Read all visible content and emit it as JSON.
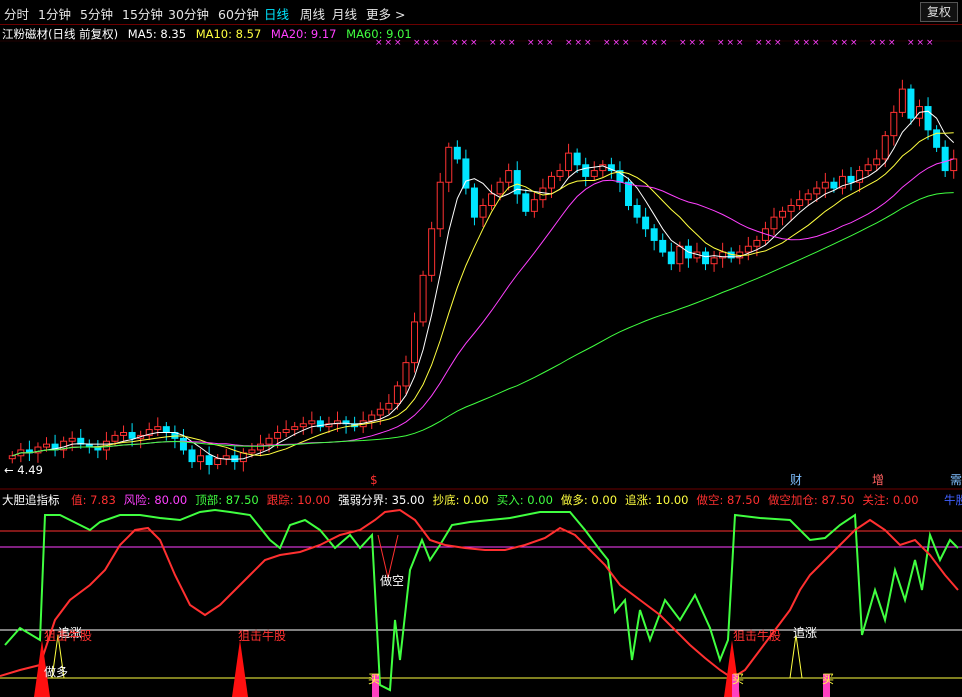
{
  "toolbar": {
    "tabs": [
      {
        "label": "分时"
      },
      {
        "label": "1分钟"
      },
      {
        "label": "5分钟"
      },
      {
        "label": "15分钟"
      },
      {
        "label": "30分钟"
      },
      {
        "label": "60分钟"
      },
      {
        "label": "日线",
        "active": true
      },
      {
        "label": "周线"
      },
      {
        "label": "月线"
      },
      {
        "label": "更多 >"
      }
    ],
    "fuquan_label": "复权"
  },
  "main_legend": {
    "title": "江粉磁材(日线 前复权)",
    "ma5": "MA5: 8.35",
    "ma10": "MA10: 8.57",
    "ma20": "MA20: 9.17",
    "ma60": "MA60: 9.01",
    "low_label": "← 4.49"
  },
  "event_markers": [
    {
      "label": "$",
      "color": "#ff3030"
    },
    {
      "label": "财",
      "color": "#7fbfff"
    },
    {
      "label": "增",
      "color": "#ff6060"
    },
    {
      "label": "需",
      "color": "#7fbfff"
    }
  ],
  "indicator_legend": {
    "name": "大胆追指标",
    "items": [
      {
        "text": "值: 7.83",
        "color": "#ff3030"
      },
      {
        "text": "风险: 80.00",
        "color": "#ff40ff"
      },
      {
        "text": "顶部: 87.50",
        "color": "#40ff40"
      },
      {
        "text": "跟踪: 10.00",
        "color": "#ff3030"
      },
      {
        "text": "强弱分界: 35.00",
        "color": "#ffffff"
      },
      {
        "text": "抄底: 0.00",
        "color": "#ffff40"
      },
      {
        "text": "买入: 0.00",
        "color": "#40ff40"
      },
      {
        "text": "做多: 0.00",
        "color": "#ffff40"
      },
      {
        "text": "追涨: 10.00",
        "color": "#ffff40"
      },
      {
        "text": "做空: 87.50",
        "color": "#ff3030"
      },
      {
        "text": "做空加仓: 87.50",
        "color": "#ff3030"
      },
      {
        "text": "关注: 0.00",
        "color": "#ff3030"
      }
    ],
    "extra": "牛股"
  },
  "signals": [
    {
      "text": "追涨",
      "color": "#ffffff"
    },
    {
      "text": "狙击牛股",
      "color": "#ff3030"
    },
    {
      "text": "狙击牛股",
      "color": "#ff3030"
    },
    {
      "text": "做空",
      "color": "#ffffff"
    },
    {
      "text": "狙击牛股",
      "color": "#ff3030"
    },
    {
      "text": "追涨",
      "color": "#ffffff"
    },
    {
      "text": "做多",
      "color": "#ffffff"
    },
    {
      "text": "买",
      "color": "#ffff40"
    },
    {
      "text": "买",
      "color": "#ffff40"
    },
    {
      "text": "买",
      "color": "#ffff40"
    }
  ],
  "colors": {
    "up": "#ff3232",
    "down": "#00e5ff",
    "ma5": "#ffffff",
    "ma10": "#ffff40",
    "ma20": "#ff40ff",
    "ma60": "#40ff40"
  },
  "chart_data": {
    "type": "candlestick",
    "price_range": [
      4.49,
      11.5
    ],
    "low_marker": 4.49,
    "closes": [
      4.7,
      4.8,
      4.75,
      4.85,
      4.9,
      4.8,
      4.95,
      5.0,
      4.9,
      4.85,
      4.8,
      4.95,
      5.05,
      5.1,
      5.0,
      5.05,
      5.15,
      5.2,
      5.1,
      5.0,
      4.8,
      4.6,
      4.7,
      4.55,
      4.65,
      4.7,
      4.6,
      4.75,
      4.8,
      4.9,
      5.0,
      5.1,
      5.15,
      5.2,
      5.25,
      5.3,
      5.2,
      5.25,
      5.3,
      5.25,
      5.2,
      5.3,
      5.4,
      5.5,
      5.6,
      5.9,
      6.3,
      7.0,
      7.8,
      8.6,
      9.4,
      10.0,
      9.8,
      9.3,
      8.8,
      9.0,
      9.2,
      9.4,
      9.6,
      9.2,
      8.9,
      9.1,
      9.3,
      9.5,
      9.6,
      9.9,
      9.7,
      9.5,
      9.6,
      9.7,
      9.6,
      9.4,
      9.0,
      8.8,
      8.6,
      8.4,
      8.2,
      8.0,
      8.3,
      8.1,
      8.2,
      8.0,
      8.1,
      8.2,
      8.1,
      8.2,
      8.3,
      8.4,
      8.6,
      8.8,
      8.9,
      9.0,
      9.1,
      9.2,
      9.3,
      9.4,
      9.3,
      9.5,
      9.4,
      9.6,
      9.7,
      9.8,
      10.2,
      10.6,
      11.0,
      10.5,
      10.7,
      10.3,
      10.0,
      9.6,
      9.8
    ]
  }
}
